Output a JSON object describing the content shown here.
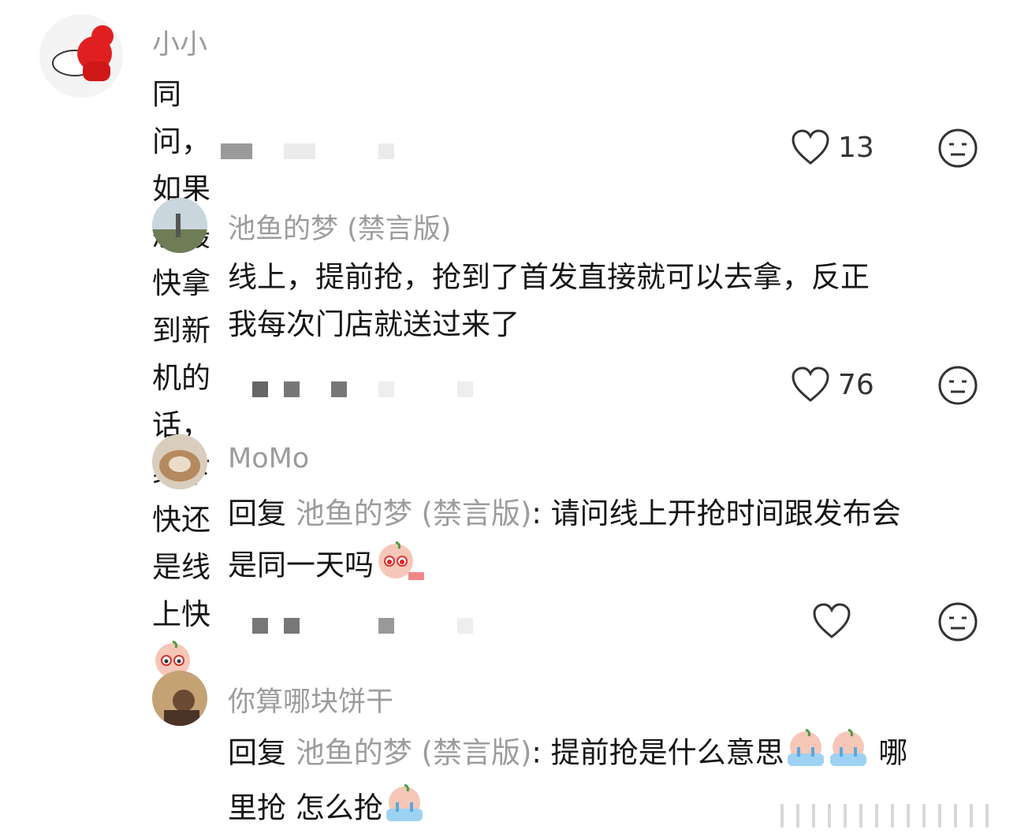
{
  "comments": [
    {
      "user": "小小",
      "text": "同问，如果想最快拿到新机的话，线下快还是线上快",
      "likes": "13",
      "emoji": "shy-peach-emoji"
    },
    {
      "user": "池鱼的梦 (禁言版)",
      "text_line1": "线上，提前抢，抢到了首发直接就可以去拿，反正",
      "text_line2": "我每次门店就送过来了",
      "likes": "76"
    },
    {
      "user": "MoMo",
      "reply_prefix": "回复",
      "reply_to": "池鱼的梦 (禁言版)",
      "text_line1": ": 请问线上开抢时间跟发布会",
      "text_line2": "是同一天吗",
      "likes": "",
      "emoji": "pleading-peach-emoji"
    },
    {
      "user": "你算哪块饼干",
      "reply_prefix": "回复",
      "reply_to": "池鱼的梦 (禁言版)",
      "text_line1": ": 提前抢是什么意思",
      "text_line1_tail": " 哪",
      "text_line2": "里抢 怎么抢",
      "emoji": "crying-peach-emoji"
    }
  ],
  "colors": {
    "username": "#9c9c9c",
    "text": "#161616",
    "icon": "#333333"
  }
}
